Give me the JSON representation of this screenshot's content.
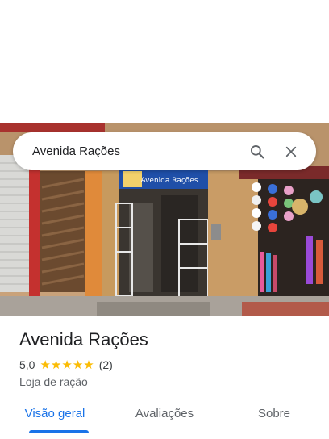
{
  "search": {
    "query": "Avenida Rações"
  },
  "icons": {
    "search": "search-icon",
    "close": "close-icon",
    "star": "star-icon"
  },
  "place": {
    "name": "Avenida Rações",
    "rating": "5,0",
    "stars": 5,
    "review_count": "(2)",
    "category": "Loja de ração",
    "storefront_sign": "Avenida Rações"
  },
  "tabs": [
    {
      "label": "Visão geral",
      "active": true
    },
    {
      "label": "Avaliações",
      "active": false
    },
    {
      "label": "Sobre",
      "active": false
    }
  ],
  "colors": {
    "accent": "#1a73e8",
    "star": "#fbbc04",
    "text_primary": "#202124",
    "text_secondary": "#5f6368"
  }
}
